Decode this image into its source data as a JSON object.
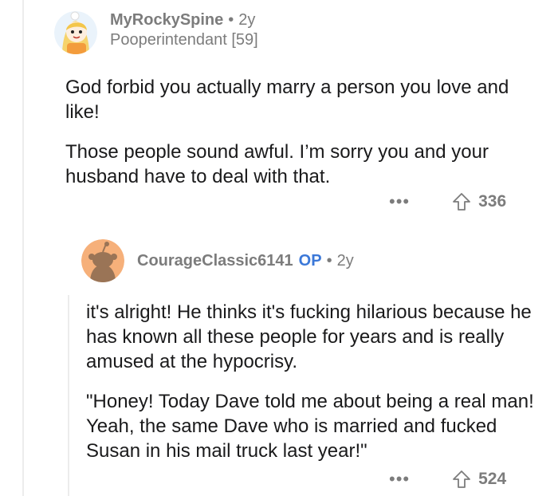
{
  "comments": [
    {
      "username": "MyRockySpine",
      "separator": "•",
      "age": "2y",
      "flair": "Pooperintendant [59]",
      "paragraphs": [
        "God forbid you actually marry a person you love and like!",
        "Those people sound awful. I’m sorry you and your husband have to deal with that."
      ],
      "more_label": "•••",
      "score": "336",
      "icons": {
        "avatar": "snoo-avatar-blonde",
        "upvote": "upvote-arrow-icon",
        "more": "more-options-icon"
      }
    },
    {
      "username": "CourageClassic6141",
      "op_badge": "OP",
      "separator": "•",
      "age": "2y",
      "paragraphs": [
        "it's alright! He thinks it's fucking hilarious because he has known all these people for years and is really amused at the hypocrisy.",
        "\"Honey! Today Dave told me about being a real man! Yeah, the same Dave who is married and fucked Susan in his mail truck last year!\""
      ],
      "more_label": "•••",
      "score": "524",
      "icons": {
        "avatar": "default-snoo-avatar",
        "upvote": "upvote-arrow-icon",
        "more": "more-options-icon"
      }
    }
  ],
  "colors": {
    "meta_gray": "#7c7c7c",
    "op_blue": "#3b78d8",
    "text": "#1a1a1b",
    "thread_line": "#ececec",
    "avatar_orange": "#f6b07a"
  }
}
